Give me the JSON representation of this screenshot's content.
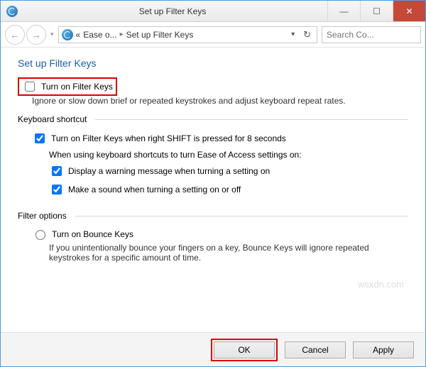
{
  "window": {
    "title": "Set up Filter Keys"
  },
  "nav": {
    "crumb1": "Ease o...",
    "crumb2": "Set up Filter Keys",
    "search_placeholder": "Search Co..."
  },
  "page": {
    "heading": "Set up Filter Keys",
    "turn_on_label": "Turn on Filter Keys",
    "turn_on_desc": "Ignore or slow down brief or repeated keystrokes and adjust keyboard repeat rates."
  },
  "keyboard_shortcut": {
    "legend": "Keyboard shortcut",
    "shift_label": "Turn on Filter Keys when right SHIFT is pressed for 8 seconds",
    "when_using": "When using keyboard shortcuts to turn Ease of Access settings on:",
    "warning_label": "Display a warning message when turning a setting on",
    "sound_label": "Make a sound when turning a setting on or off"
  },
  "filter_options": {
    "legend": "Filter options",
    "bounce_label": "Turn on Bounce Keys",
    "bounce_desc": "If you unintentionally bounce your fingers on a key, Bounce Keys will ignore repeated keystrokes for a specific amount of time."
  },
  "buttons": {
    "ok": "OK",
    "cancel": "Cancel",
    "apply": "Apply"
  },
  "watermark": "wsxdn.com"
}
